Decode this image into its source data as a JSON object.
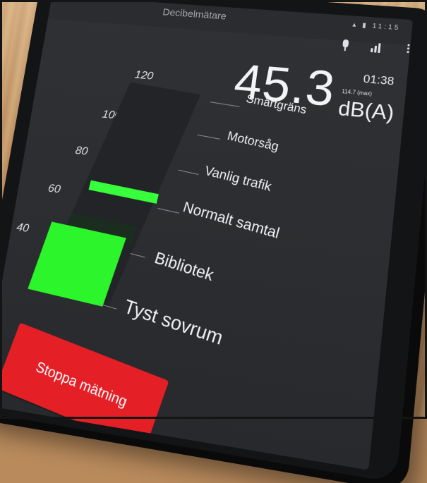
{
  "app": {
    "title": "Decibelmätare"
  },
  "status": {
    "time": "11:15"
  },
  "toolbar": {
    "mic_icon": "mic-icon",
    "chart_icon": "bar-chart-icon",
    "menu_icon": "overflow-menu-icon"
  },
  "meter": {
    "timer": "01:38",
    "current_db": "45.3",
    "max_label": "114.7 (max)",
    "unit": "dB(A)",
    "scale": [
      "120",
      "100",
      "80",
      "60",
      "40"
    ],
    "level_fraction": 0.41,
    "peak_fraction": 0.58,
    "fill_color": "#2cf52b"
  },
  "references": [
    "Smärtgräns",
    "Motorsåg",
    "Vanlig trafik",
    "Normalt samtal",
    "Bibliotek",
    "Tyst sovrum"
  ],
  "actions": {
    "stop_label": "Stoppa mätning",
    "stop_color": "#e41f26"
  }
}
